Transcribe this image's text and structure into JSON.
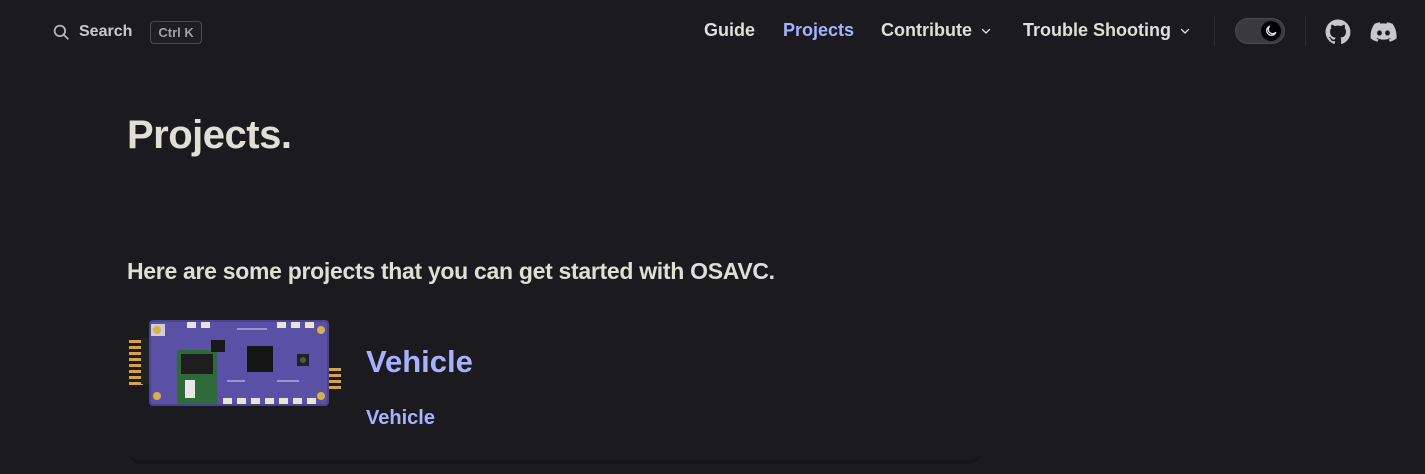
{
  "nav": {
    "search_label": "Search",
    "search_shortcut": "Ctrl K",
    "links": [
      {
        "label": "Guide"
      },
      {
        "label": "Projects"
      },
      {
        "label": "Contribute"
      },
      {
        "label": "Trouble Shooting"
      }
    ],
    "active_link": "Projects",
    "icons": [
      "search-icon",
      "chevron-down-icon",
      "moon-icon",
      "github-icon",
      "discord-icon"
    ],
    "accent_color": "#a8b1ff",
    "background_color": "#1b1b1f"
  },
  "page": {
    "title": "Projects.",
    "intro": "Here are some projects that you can get started with OSAVC.",
    "projects": [
      {
        "title": "Vehicle",
        "description": "Vehicle",
        "image": "osavc-board-image"
      }
    ]
  }
}
